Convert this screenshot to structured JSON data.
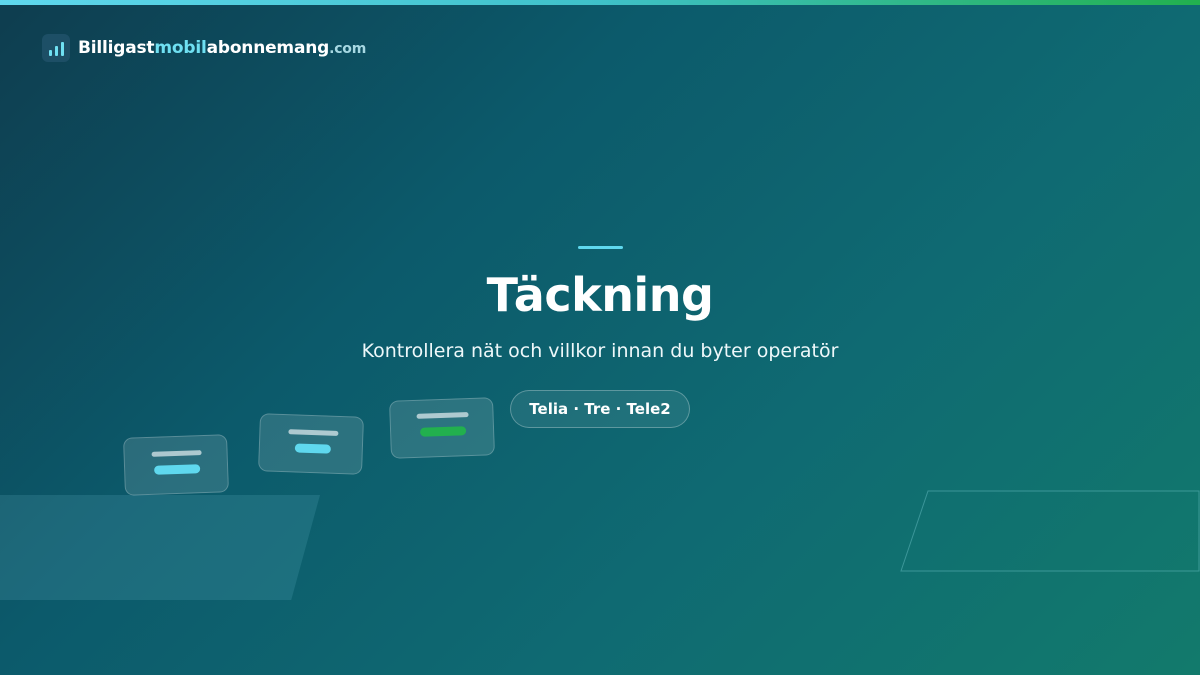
{
  "brand": {
    "part1": "Billigast",
    "part2": "mobil",
    "part3": "abonnemang",
    "tld": ".com",
    "icon": "signal-bars-icon"
  },
  "hero": {
    "title": "Täckning",
    "subtitle": "Kontrollera nät och villkor innan du byter operatör",
    "operators_pill": "Telia · Tre · Tele2"
  },
  "colors": {
    "accent_cyan": "#5fd8ee",
    "accent_green": "#22b04e",
    "background_dark": "#0e3d4f",
    "background_teal": "#127a6c"
  }
}
